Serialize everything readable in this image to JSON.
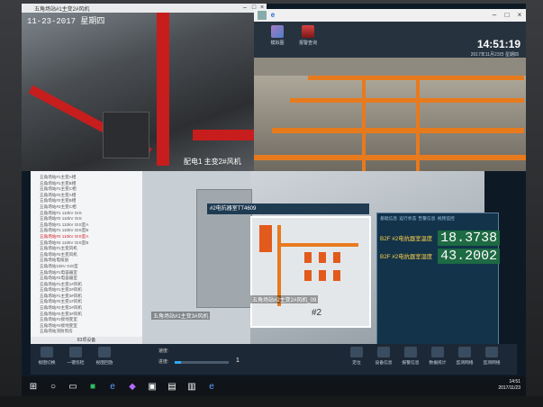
{
  "camera_window": {
    "title": "五角场站#1主变2#风机",
    "timestamp": "11-23-2017 星期四",
    "overlay_label": "配电1 主变2#风机"
  },
  "scada_window": {
    "toolbar": [
      {
        "label": "模拟图",
        "icon": "map-icon"
      },
      {
        "label": "报警查询",
        "icon": "alarm-icon"
      }
    ],
    "time": "14:51:19",
    "date": "2017年11月23日 星期四"
  },
  "device_list": {
    "items": [
      {
        "label": "五角场站#1主变A相",
        "alarm": false
      },
      {
        "label": "五角场站#1主变B相",
        "alarm": false
      },
      {
        "label": "五角场站#1主变C相",
        "alarm": false
      },
      {
        "label": "五角场站#2主变A相",
        "alarm": false
      },
      {
        "label": "五角场站#2主变B相",
        "alarm": false
      },
      {
        "label": "五角场站#2主变C相",
        "alarm": false
      },
      {
        "label": "五角场站#1 110kV GIS",
        "alarm": false
      },
      {
        "label": "五角场站#2 110kV GIS",
        "alarm": false
      },
      {
        "label": "五角场站#1 110kV GIS室A",
        "alarm": false
      },
      {
        "label": "五角场站#1 110kV GIS室B",
        "alarm": false
      },
      {
        "label": "五角场站#2 110kV GIS室A",
        "alarm": true
      },
      {
        "label": "五角场站#2 110kV GIS室B",
        "alarm": false
      },
      {
        "label": "五角场站#1主变风机",
        "alarm": false
      },
      {
        "label": "五角场站#2主变风机",
        "alarm": false
      },
      {
        "label": "五角场站电缆层",
        "alarm": false
      },
      {
        "label": "五角场站10kV GIS室",
        "alarm": false
      },
      {
        "label": "五角场站#1电容器室",
        "alarm": false
      },
      {
        "label": "五角场站#2电容器室",
        "alarm": false
      },
      {
        "label": "五角场站#1主变1#风机",
        "alarm": false
      },
      {
        "label": "五角场站#1主变2#风机",
        "alarm": false
      },
      {
        "label": "五角场站#1主变3#风机",
        "alarm": false
      },
      {
        "label": "五角场站#2主变1#风机",
        "alarm": false
      },
      {
        "label": "五角场站#2主变2#风机",
        "alarm": false
      },
      {
        "label": "五角场站#2主变3#风机",
        "alarm": false
      },
      {
        "label": "五角场站#1接地变室",
        "alarm": false
      },
      {
        "label": "五角场站#2接地变室",
        "alarm": false
      },
      {
        "label": "五角场站消防泵房",
        "alarm": false
      }
    ],
    "footer": "83项设备"
  },
  "scene": {
    "label_left": "五角场站#1主变3#风机",
    "label_right": "五角场站#2主变2#风机_09",
    "label_number": "#2",
    "tooltip": "#2电抗器室TT4609"
  },
  "data_panel": {
    "tabs": [
      "基础信息",
      "运行状态",
      "告警信息",
      "视频监控"
    ],
    "readings": [
      {
        "label": "B2F #2电抗器室温度",
        "value": "18.3738"
      },
      {
        "label": "B2F #2电抗器室湿度",
        "value": "43.2002"
      }
    ]
  },
  "control_bar": {
    "left_buttons": [
      {
        "label": "视图切换",
        "icon": "view-icon"
      },
      {
        "label": "一键巡检",
        "icon": "patrol-icon"
      },
      {
        "label": "视图回放",
        "icon": "playback-icon"
      }
    ],
    "speed_label": "速度:",
    "progress_label": "进度:",
    "progress_value": "1",
    "progress_fraction": 0.12,
    "right_buttons": [
      {
        "label": "定位",
        "icon": "locate-icon"
      },
      {
        "label": "设备信息",
        "icon": "info-icon"
      },
      {
        "label": "报警信息",
        "icon": "alarm-icon"
      },
      {
        "label": "数据统计",
        "icon": "stats-icon"
      },
      {
        "label": "监测网络",
        "icon": "network-icon"
      },
      {
        "label": "监测网络",
        "icon": "network-icon"
      }
    ]
  },
  "taskbar": {
    "time": "14:51",
    "date": "2017/11/23"
  }
}
